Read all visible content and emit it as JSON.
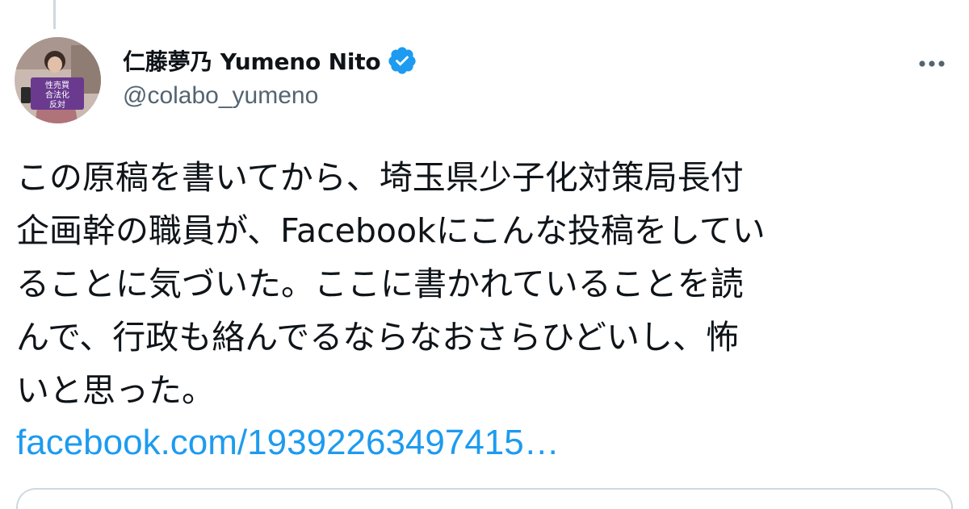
{
  "tweet": {
    "author": {
      "display_name": "仁藤夢乃 Yumeno Nito",
      "handle": "@colabo_yumeno",
      "verified": true,
      "avatar_sign_text": [
        "性売買",
        "合法化",
        "反対"
      ]
    },
    "text_lines": [
      "この原稿を書いてから、埼玉県少子化対策局長付",
      "企画幹の職員が、Facebookにこんな投稿をしてい",
      "ることに気づいた。ここに書かれていることを読",
      "んで、行政も絡んでるならなおさらひどいし、怖",
      "いと思った。"
    ],
    "link_text": "facebook.com/1939226349741​5…"
  },
  "icons": {
    "verified": "verified-badge-icon",
    "more": "more-horizontal-icon"
  },
  "colors": {
    "text": "#0f1419",
    "secondary": "#536471",
    "link": "#1d9bf0",
    "verified": "#1d9bf0",
    "border": "#cfd9de"
  }
}
